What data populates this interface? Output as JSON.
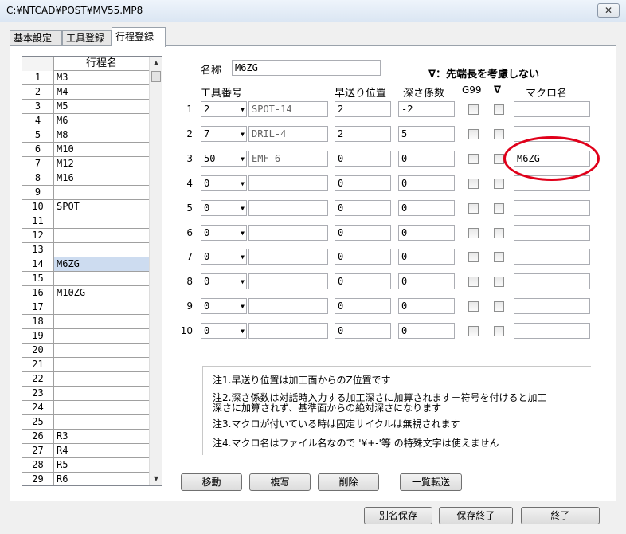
{
  "window": {
    "title": "C:¥NTCAD¥POST¥MV55.MP8",
    "close_label": "✕"
  },
  "tabs": [
    {
      "label": "基本設定"
    },
    {
      "label": "工具登録"
    },
    {
      "label": "行程登録"
    }
  ],
  "process_list": {
    "header_num": "",
    "header_name": "行程名",
    "selected": "14",
    "rows": [
      {
        "num": "1",
        "name": "M3"
      },
      {
        "num": "2",
        "name": "M4"
      },
      {
        "num": "3",
        "name": "M5"
      },
      {
        "num": "4",
        "name": "M6"
      },
      {
        "num": "5",
        "name": "M8"
      },
      {
        "num": "6",
        "name": "M10"
      },
      {
        "num": "7",
        "name": "M12"
      },
      {
        "num": "8",
        "name": "M16"
      },
      {
        "num": "9",
        "name": ""
      },
      {
        "num": "10",
        "name": "SPOT"
      },
      {
        "num": "11",
        "name": ""
      },
      {
        "num": "12",
        "name": ""
      },
      {
        "num": "13",
        "name": ""
      },
      {
        "num": "14",
        "name": "M6ZG"
      },
      {
        "num": "15",
        "name": ""
      },
      {
        "num": "16",
        "name": "M10ZG"
      },
      {
        "num": "17",
        "name": ""
      },
      {
        "num": "18",
        "name": ""
      },
      {
        "num": "19",
        "name": ""
      },
      {
        "num": "20",
        "name": ""
      },
      {
        "num": "21",
        "name": ""
      },
      {
        "num": "22",
        "name": ""
      },
      {
        "num": "23",
        "name": ""
      },
      {
        "num": "24",
        "name": ""
      },
      {
        "num": "25",
        "name": ""
      },
      {
        "num": "26",
        "name": "R3"
      },
      {
        "num": "27",
        "name": "R4"
      },
      {
        "num": "28",
        "name": "R5"
      },
      {
        "num": "29",
        "name": "R6"
      }
    ]
  },
  "form": {
    "name_label": "名称",
    "name_value": "M6ZG",
    "note_top": "∇：先端長を考慮しない",
    "headers": {
      "tool_no": "工具番号",
      "rapid_pos": "早送り位置",
      "depth_coef": "深さ係数",
      "g99": "G99",
      "nabla": "∇",
      "macro": "マクロ名"
    },
    "rows": [
      {
        "idx": "1",
        "tool": "2",
        "tool_name": "SPOT-14",
        "rapid": "2",
        "depth": "-2",
        "macro": ""
      },
      {
        "idx": "2",
        "tool": "7",
        "tool_name": "DRIL-4",
        "rapid": "2",
        "depth": "5",
        "macro": ""
      },
      {
        "idx": "3",
        "tool": "50",
        "tool_name": "EMF-6",
        "rapid": "0",
        "depth": "0",
        "macro": "M6ZG"
      },
      {
        "idx": "4",
        "tool": "0",
        "tool_name": "",
        "rapid": "0",
        "depth": "0",
        "macro": ""
      },
      {
        "idx": "5",
        "tool": "0",
        "tool_name": "",
        "rapid": "0",
        "depth": "0",
        "macro": ""
      },
      {
        "idx": "6",
        "tool": "0",
        "tool_name": "",
        "rapid": "0",
        "depth": "0",
        "macro": ""
      },
      {
        "idx": "7",
        "tool": "0",
        "tool_name": "",
        "rapid": "0",
        "depth": "0",
        "macro": ""
      },
      {
        "idx": "8",
        "tool": "0",
        "tool_name": "",
        "rapid": "0",
        "depth": "0",
        "macro": ""
      },
      {
        "idx": "9",
        "tool": "0",
        "tool_name": "",
        "rapid": "0",
        "depth": "0",
        "macro": ""
      },
      {
        "idx": "10",
        "tool": "0",
        "tool_name": "",
        "rapid": "0",
        "depth": "0",
        "macro": ""
      }
    ]
  },
  "notes": [
    "注1.早送り位置は加工面からのZ位置です",
    "注2.深さ係数は対話時入力する加工深さに加算されます－符号を付けると加工",
    "深さに加算されず、基準面からの絶対深さになります",
    "注3.マクロが付いている時は固定サイクルは無視されます",
    "注4.マクロ名はファイル名なので '¥+-'等 の特殊文字は使えません"
  ],
  "actions": {
    "move": "移動",
    "copy": "複写",
    "delete": "削除",
    "list_transfer": "一覧転送"
  },
  "footer": {
    "save_as": "別名保存",
    "save_exit": "保存終了",
    "exit": "終了"
  },
  "colors": {
    "highlight_ellipse": "#e0001a",
    "selected_row": "#cddcf0"
  }
}
